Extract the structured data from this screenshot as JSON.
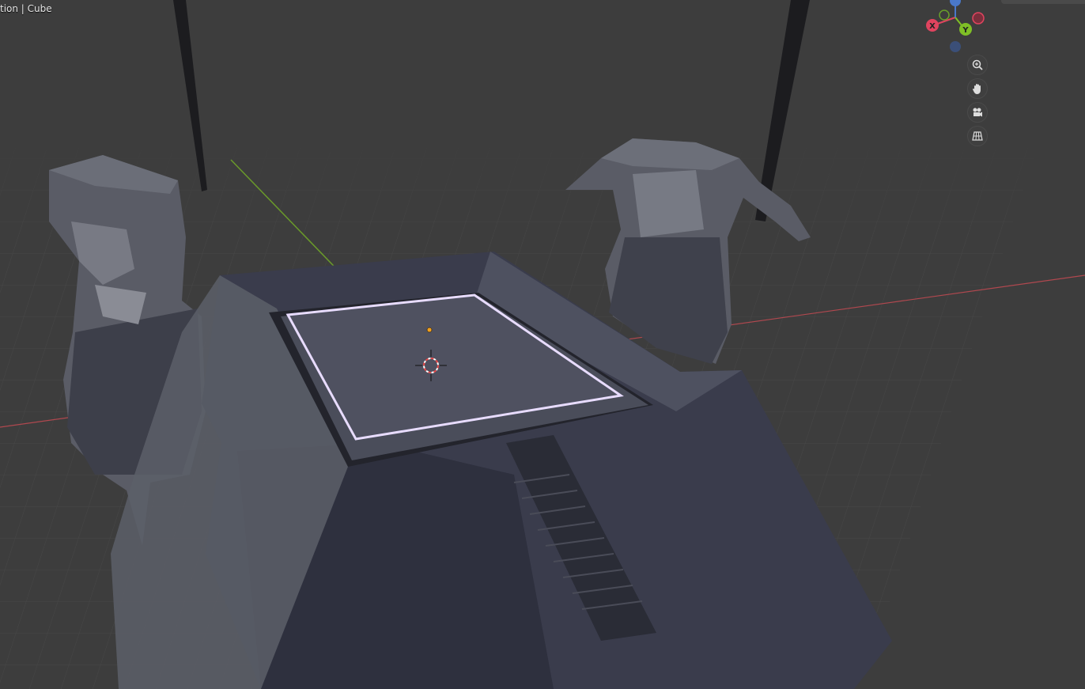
{
  "viewport": {
    "overlay_info": "tion | Cube"
  },
  "gizmo": {
    "x_label": "X",
    "y_label": "Y",
    "colors": {
      "x": "#e0445f",
      "y": "#7fbf26",
      "z": "#4a78c9"
    }
  },
  "navigation": {
    "zoom": "zoom-icon",
    "pan": "hand-icon",
    "camera": "camera-icon",
    "perspective": "grid-icon"
  },
  "axes_colors": {
    "x_axis": "#b0484f",
    "y_axis": "#6a9a2a"
  }
}
